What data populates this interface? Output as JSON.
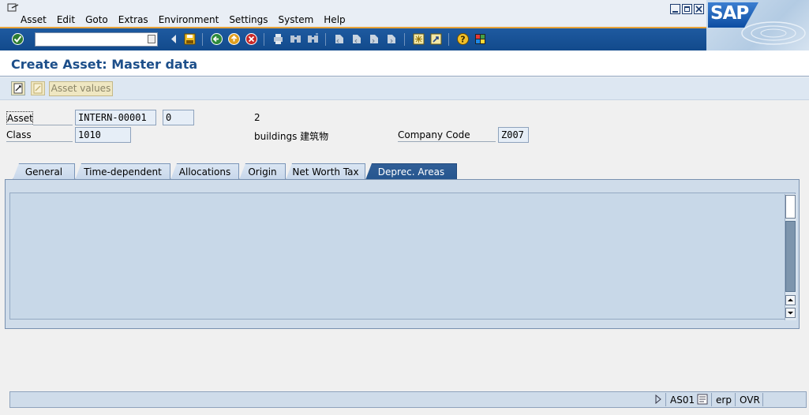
{
  "menu": {
    "items": [
      "Asset",
      "Edit",
      "Goto",
      "Extras",
      "Environment",
      "Settings",
      "System",
      "Help"
    ]
  },
  "brand": {
    "logo_text": "SAP"
  },
  "page": {
    "title": "Create Asset:  Master data",
    "asset_values_button": "Asset values"
  },
  "header": {
    "asset_label": "Asset",
    "asset_number": "INTERN-00001",
    "asset_subnumber": "0",
    "asset_text": "2",
    "class_label": "Class",
    "class_value": "1010",
    "class_description": "buildings 建筑物",
    "company_code_label": "Company Code",
    "company_code_value": "Z007"
  },
  "tabs": [
    {
      "label": "General",
      "active": false
    },
    {
      "label": "Time-dependent",
      "active": false
    },
    {
      "label": "Allocations",
      "active": false
    },
    {
      "label": "Origin",
      "active": false
    },
    {
      "label": "Net Worth Tax",
      "active": false
    },
    {
      "label": "Deprec. Areas",
      "active": true
    }
  ],
  "status": {
    "transaction": "AS01",
    "system": "erp",
    "mode": "OVR"
  },
  "colors": {
    "accent_orange": "#e8a33a",
    "toolbar_blue": "#1e5aa0",
    "title_blue": "#1d4f8a",
    "active_tab": "#315f97"
  }
}
